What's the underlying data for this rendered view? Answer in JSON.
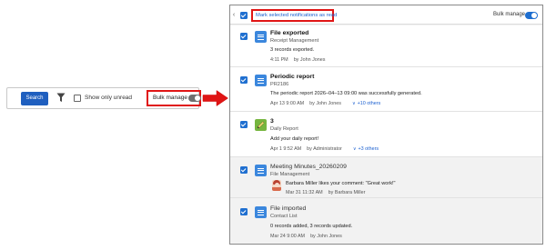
{
  "toolbar": {
    "search_label": "Search",
    "filter_icon": "filter-icon",
    "show_only_unread_label": "Show only unread",
    "show_only_unread_checked": false,
    "bulk_manage_label": "Bulk manage",
    "bulk_manage_enabled": false
  },
  "panel": {
    "mark_read_label": "Mark selected notifications as read",
    "bulk_manage_label": "Bulk manage",
    "bulk_manage_enabled": true,
    "collapse_glyph": "‹",
    "items": [
      {
        "title": "File exported",
        "source": "Receipt Management",
        "body": "3 records exported.",
        "time": "4:11 PM",
        "author": "by John Jones",
        "more": "",
        "selected": true,
        "read": false,
        "icon": "document-icon"
      },
      {
        "title": "Periodic report",
        "source": "PR2186",
        "body": "The periodic report 2026–04–13 09:00 was successfully generated.",
        "time": "Apr 13 9:00 AM",
        "author": "by John Jones",
        "more": "+10 others",
        "selected": true,
        "read": false,
        "icon": "document-icon"
      },
      {
        "title": "3",
        "source": "Daily Report",
        "body": "Add your daily report!",
        "time": "Apr 1 9:52 AM",
        "author": "by Administrator",
        "more": "+3 others",
        "selected": true,
        "read": false,
        "icon": "pencil-icon"
      },
      {
        "title": "Meeting Minutes_20260209",
        "source": "File Management",
        "body": "Barbara Miller likes your comment: \"Great work!\"",
        "time": "Mar 31 11:32 AM",
        "author": "by Barbara Miller",
        "more": "",
        "selected": true,
        "read": true,
        "icon": "document-icon"
      },
      {
        "title": "File imported",
        "source": "Contact List",
        "body": "0 records added, 3 records updated.",
        "time": "Mar 24 9:00 AM",
        "author": "by John Jones",
        "more": "",
        "selected": true,
        "read": true,
        "icon": "document-icon"
      }
    ]
  },
  "colors": {
    "accent": "#1f6fd0",
    "highlight": "#e01515",
    "search_button": "#1f5fbf",
    "doc_icon": "#3b87dd",
    "pencil_icon": "#76b53f"
  }
}
